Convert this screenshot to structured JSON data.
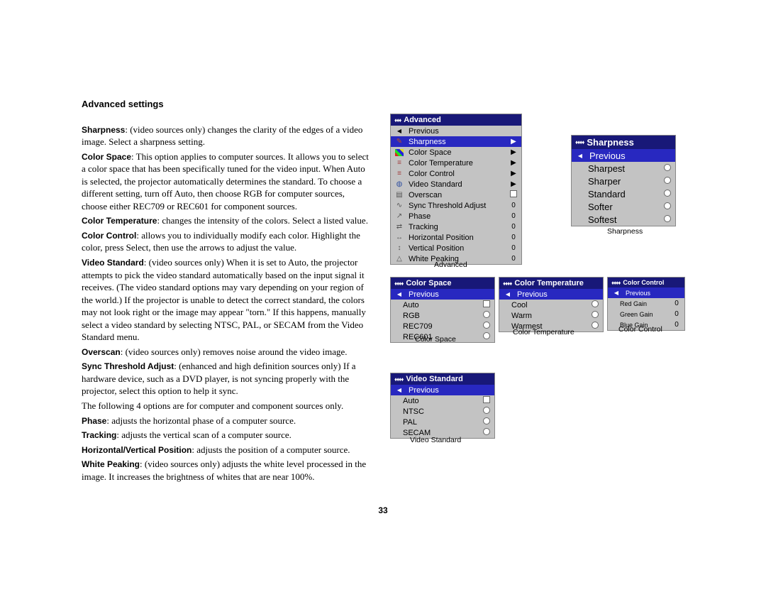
{
  "heading": "Advanced settings",
  "paras": [
    {
      "b": "Sharpness",
      "t": ": (video sources only) changes the clarity of the edges of a video image. Select a sharpness setting."
    },
    {
      "b": "Color Space",
      "t": ": This option applies to computer sources. It allows you to select a color space that has been specifically tuned for the video input. When Auto is selected, the projector automatically determines the standard. To choose a different setting, turn off Auto, then choose RGB for computer sources, choose either REC709 or REC601 for component sources."
    },
    {
      "b": "Color Temperature",
      "t": ": changes the intensity of the colors. Select a listed value."
    },
    {
      "b": "Color Control",
      "t": ": allows you to individually modify each color. Highlight the color, press Select, then use the arrows to adjust the value."
    },
    {
      "b": "Video Standard",
      "t": ": (video sources only) When it is set to Auto, the projector attempts to pick the video standard automatically based on the input signal it receives. (The video standard options may vary depending on your region of the world.) If the projector is unable to detect the correct standard, the colors may not look right or the image may appear \"torn.\" If this happens, manually select a video standard by selecting NTSC, PAL, or SECAM from the Video Standard menu."
    },
    {
      "b": "Overscan",
      "t": ": (video sources only) removes noise around the video image."
    },
    {
      "b": "Sync Threshold Adjust",
      "t": ": (enhanced and high definition sources only) If a hardware device, such as a DVD player, is not syncing properly with the projector, select this option to help it sync."
    },
    {
      "b": "",
      "t": "The following 4 options are for computer and component sources only."
    },
    {
      "b": "Phase",
      "t": ": adjusts the horizontal phase of a computer source."
    },
    {
      "b": "Tracking",
      "t": ": adjusts the vertical scan of a computer source."
    },
    {
      "b": "Horizontal/Vertical Position",
      "t": ": adjusts the position of a computer source."
    },
    {
      "b": "White Peaking",
      "t": ": (video sources only) adjusts the white level processed in the image. It increases the brightness of whites that are near 100%."
    }
  ],
  "page_number": "33",
  "menu_advanced": {
    "title": "Advanced",
    "level": "♦♦♦",
    "caption": "Advanced",
    "items": [
      {
        "icon": "ic-tri-left",
        "label": "Previous",
        "ctrl": ""
      },
      {
        "icon": "ic-pencil",
        "label": "Sharpness",
        "ctrl": "▶",
        "sel": true
      },
      {
        "icon": "ic-mix",
        "label": "Color Space",
        "ctrl": "▶"
      },
      {
        "icon": "ic-bars",
        "label": "Color Temperature",
        "ctrl": "▶"
      },
      {
        "icon": "ic-bars",
        "label": "Color Control",
        "ctrl": "▶"
      },
      {
        "icon": "ic-globe",
        "label": "Video Standard",
        "ctrl": "▶"
      },
      {
        "icon": "ic-scan",
        "label": "Overscan",
        "ctrl": "chk"
      },
      {
        "icon": "ic-wave",
        "label": "Sync Threshold Adjust",
        "ctrl": "0"
      },
      {
        "icon": "ic-chart",
        "label": "Phase",
        "ctrl": "0"
      },
      {
        "icon": "ic-arrows",
        "label": "Tracking",
        "ctrl": "0"
      },
      {
        "icon": "ic-hpos",
        "label": "Horizontal Position",
        "ctrl": "0"
      },
      {
        "icon": "ic-vpos",
        "label": "Vertical Position",
        "ctrl": "0"
      },
      {
        "icon": "ic-peak",
        "label": "White Peaking",
        "ctrl": "0"
      }
    ]
  },
  "menu_sharpness": {
    "title": "Sharpness",
    "level": "♦♦♦♦",
    "caption": "Sharpness",
    "previous_label": "Previous",
    "items": [
      {
        "label": "Sharpest",
        "ctrl": "radio"
      },
      {
        "label": "Sharper",
        "ctrl": "radio"
      },
      {
        "label": "Standard",
        "ctrl": "radio"
      },
      {
        "label": "Softer",
        "ctrl": "radio"
      },
      {
        "label": "Softest",
        "ctrl": "radio"
      }
    ]
  },
  "menu_color_space": {
    "title": "Color Space",
    "level": "♦♦♦♦",
    "caption": "Color Space",
    "previous_label": "Previous",
    "items": [
      {
        "label": "Auto",
        "ctrl": "chk"
      },
      {
        "label": "RGB",
        "ctrl": "radio"
      },
      {
        "label": "REC709",
        "ctrl": "radio"
      },
      {
        "label": "REC601",
        "ctrl": "radio"
      }
    ]
  },
  "menu_color_temperature": {
    "title": "Color Temperature",
    "level": "♦♦♦♦",
    "caption": "Color Temperature",
    "previous_label": "Previous",
    "items": [
      {
        "label": "Cool",
        "ctrl": "radio"
      },
      {
        "label": "Warm",
        "ctrl": "radio"
      },
      {
        "label": "Warmest",
        "ctrl": "radio"
      }
    ]
  },
  "menu_color_control": {
    "title": "Color Control",
    "level": "♦♦♦♦",
    "caption": "Color Control",
    "previous_label": "Previous",
    "items": [
      {
        "label": "Red Gain",
        "ctrl": "0"
      },
      {
        "label": "Green Gain",
        "ctrl": "0"
      },
      {
        "label": "Blue Gain",
        "ctrl": "0"
      }
    ]
  },
  "menu_video_standard": {
    "title": "Video Standard",
    "level": "♦♦♦♦",
    "caption": "Video Standard",
    "previous_label": "Previous",
    "items": [
      {
        "label": "Auto",
        "ctrl": "chk"
      },
      {
        "label": "NTSC",
        "ctrl": "radio"
      },
      {
        "label": "PAL",
        "ctrl": "radio"
      },
      {
        "label": "SECAM",
        "ctrl": "radio"
      }
    ]
  }
}
